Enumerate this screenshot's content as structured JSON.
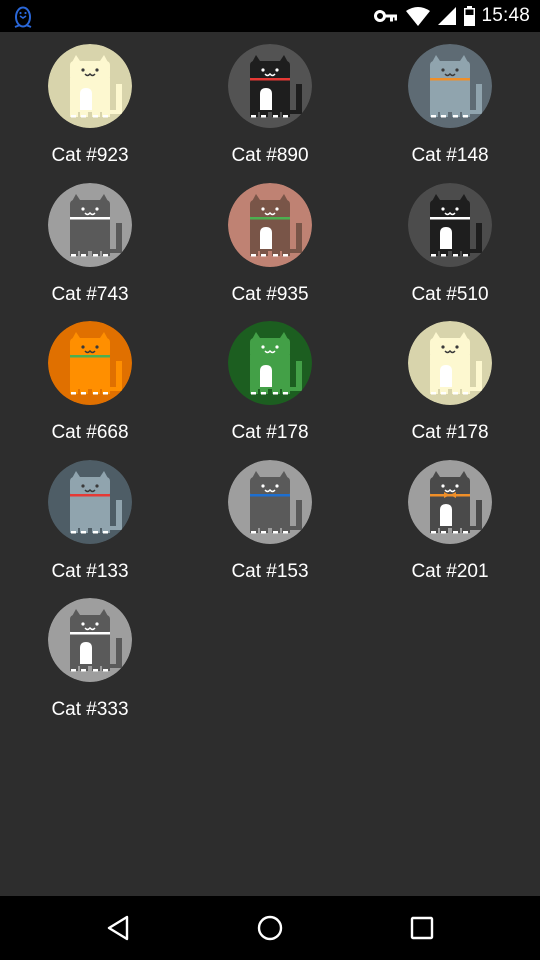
{
  "status_bar": {
    "time": "15:48",
    "icons": [
      "penguin-notification-icon",
      "vpn-key-icon",
      "wifi-icon",
      "signal-icon",
      "battery-icon"
    ]
  },
  "cats": [
    {
      "name": "Cat #923",
      "bg": "#d8d4ac",
      "body": "#fdf8d0",
      "collar": null,
      "bow": false,
      "belly": true,
      "light_face": true
    },
    {
      "name": "Cat #890",
      "bg": "#535353",
      "body": "#1e1e1e",
      "collar": "#e53935",
      "bow": false,
      "belly": true,
      "light_face": false
    },
    {
      "name": "Cat #148",
      "bg": "#5e6b74",
      "body": "#90a4ae",
      "collar": "#ef8f29",
      "bow": false,
      "belly": false,
      "light_face": true
    },
    {
      "name": "Cat #743",
      "bg": "#9e9e9e",
      "body": "#5a5a5a",
      "collar": "#ffffff",
      "bow": false,
      "belly": false,
      "light_face": false
    },
    {
      "name": "Cat #935",
      "bg": "#bf8273",
      "body": "#795548",
      "collar": "#4caf50",
      "bow": false,
      "belly": true,
      "light_face": false
    },
    {
      "name": "Cat #510",
      "bg": "#4c4c4c",
      "body": "#1e1e1e",
      "collar": "#ffffff",
      "bow": false,
      "belly": true,
      "light_face": false
    },
    {
      "name": "Cat #668",
      "bg": "#e07000",
      "body": "#ff8f00",
      "collar": "#4caf50",
      "bow": false,
      "belly": false,
      "light_face": true
    },
    {
      "name": "Cat #178",
      "bg": "#1c5e20",
      "body": "#43a047",
      "collar": null,
      "bow": false,
      "belly": true,
      "light_face": false
    },
    {
      "name": "Cat #178",
      "bg": "#d8d4ac",
      "body": "#fdf8d0",
      "collar": null,
      "bow": false,
      "belly": true,
      "light_face": true
    },
    {
      "name": "Cat #133",
      "bg": "#4e5d66",
      "body": "#90a4ae",
      "collar": "#e53935",
      "bow": false,
      "belly": false,
      "light_face": true
    },
    {
      "name": "Cat #153",
      "bg": "#9e9e9e",
      "body": "#5a5a5a",
      "collar": "#1e6fd0",
      "bow": false,
      "belly": false,
      "light_face": false
    },
    {
      "name": "Cat #201",
      "bg": "#9e9e9e",
      "body": "#4a4a4a",
      "collar": "#ef8f29",
      "bow": true,
      "belly": true,
      "light_face": false
    },
    {
      "name": "Cat #333",
      "bg": "#9e9e9e",
      "body": "#5a5a5a",
      "collar": "#ffffff",
      "bow": false,
      "belly": true,
      "light_face": false
    }
  ],
  "nav_bar": {
    "buttons": [
      "back-icon",
      "home-icon",
      "recents-icon"
    ]
  }
}
